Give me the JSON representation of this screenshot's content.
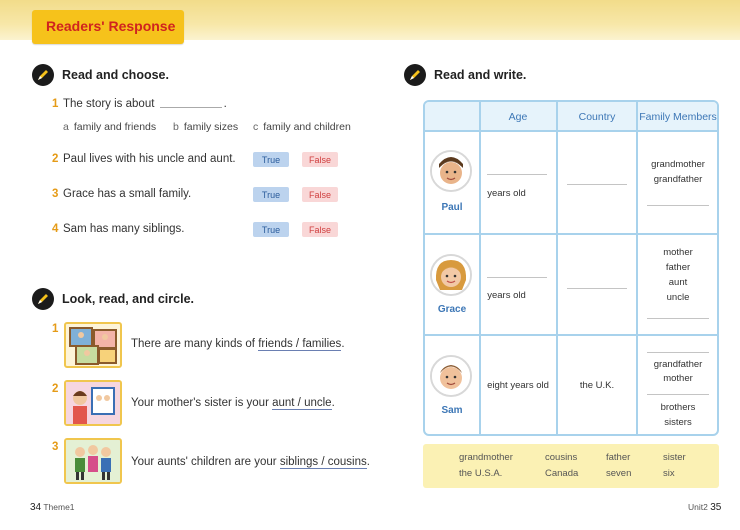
{
  "header": {
    "tab_label": "Readers' Response"
  },
  "left": {
    "section1": {
      "title": "Read and choose.",
      "q1": {
        "num": "1",
        "text_before": "The story is about",
        "text_after": ".",
        "options": [
          {
            "letter": "a",
            "text": "family and friends"
          },
          {
            "letter": "b",
            "text": "family sizes"
          },
          {
            "letter": "c",
            "text": "family and children"
          }
        ]
      },
      "q2": {
        "num": "2",
        "text": "Paul lives with his uncle and aunt."
      },
      "q3": {
        "num": "3",
        "text": "Grace has a small family."
      },
      "q4": {
        "num": "4",
        "text": "Sam has many siblings."
      },
      "true_label": "True",
      "false_label": "False"
    },
    "section2": {
      "title": "Look, read, and circle.",
      "items": [
        {
          "num": "1",
          "before": "There are many kinds of",
          "choice": "friends / families",
          "after": "."
        },
        {
          "num": "2",
          "before": "Your mother's sister is your",
          "choice": "aunt / uncle",
          "after": "."
        },
        {
          "num": "3",
          "before": "Your aunts' children are your",
          "choice": "siblings / cousins",
          "after": "."
        }
      ]
    },
    "folio": {
      "page": "34",
      "label": "Theme1"
    }
  },
  "right": {
    "title": "Read and write.",
    "table": {
      "headers": [
        "Age",
        "Country",
        "Family Members"
      ],
      "rows": [
        {
          "name": "Paul",
          "age": "years old",
          "country": "",
          "family": [
            "grandmother",
            "grandfather"
          ]
        },
        {
          "name": "Grace",
          "age": "years old",
          "country": "",
          "family": [
            "mother",
            "father",
            "aunt",
            "uncle"
          ]
        },
        {
          "name": "Sam",
          "age": "eight years old",
          "country": "the U.K.",
          "family": [
            "grandfather",
            "mother",
            "brothers",
            "sisters"
          ]
        }
      ]
    },
    "word_bank": [
      [
        "grandmother",
        "cousins",
        "father",
        "sister"
      ],
      [
        "the U.S.A.",
        "Canada",
        "seven",
        "six"
      ]
    ],
    "folio": {
      "label": "Unit2",
      "page": "35"
    }
  }
}
